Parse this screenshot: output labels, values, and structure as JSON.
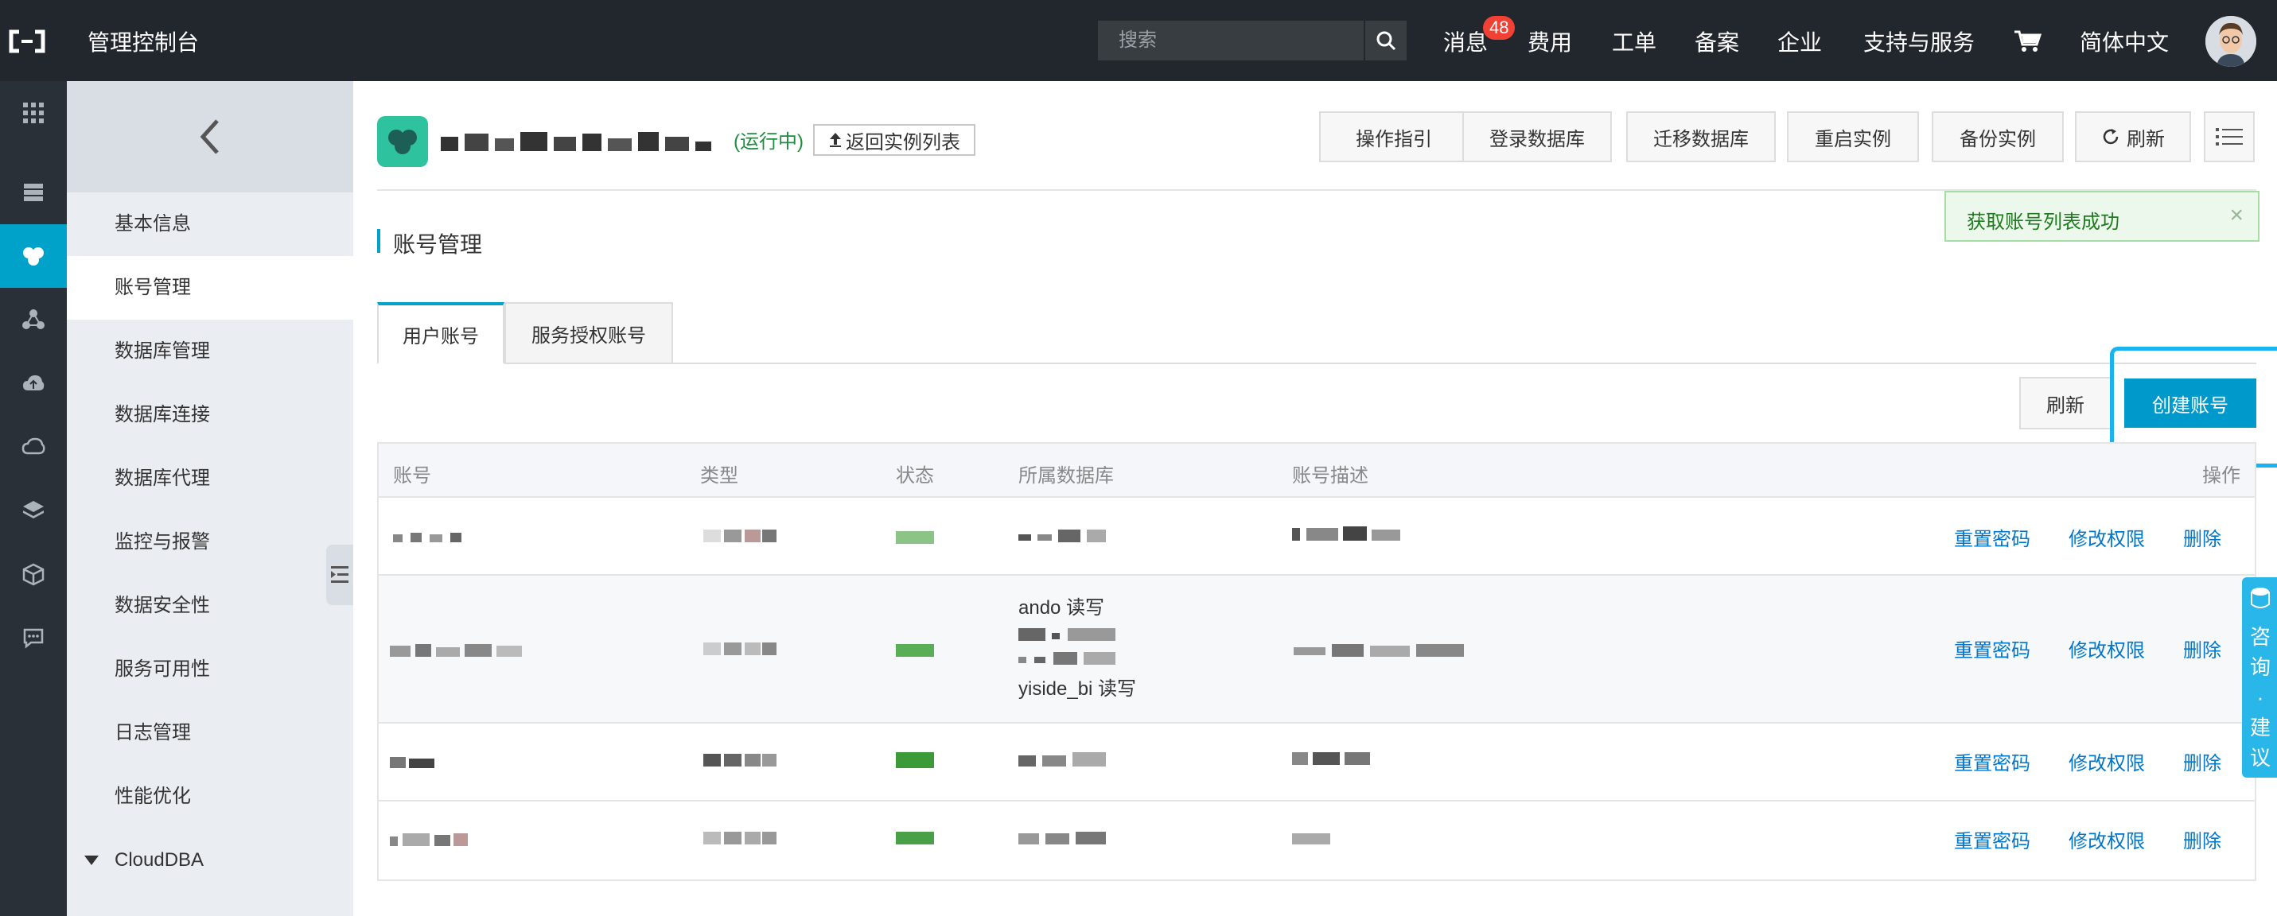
{
  "topbar": {
    "console_title": "管理控制台",
    "search_placeholder": "搜索",
    "messages_label": "消息",
    "messages_badge": "48",
    "nav": [
      "费用",
      "工单",
      "备案",
      "企业",
      "支持与服务"
    ],
    "language": "简体中文"
  },
  "sidebar": {
    "items": [
      {
        "label": "基本信息"
      },
      {
        "label": "账号管理"
      },
      {
        "label": "数据库管理"
      },
      {
        "label": "数据库连接"
      },
      {
        "label": "数据库代理"
      },
      {
        "label": "监控与报警"
      },
      {
        "label": "数据安全性"
      },
      {
        "label": "服务可用性"
      },
      {
        "label": "日志管理"
      },
      {
        "label": "性能优化"
      },
      {
        "label": "CloudDBA"
      }
    ],
    "active_index": 1
  },
  "instance": {
    "status": "(运行中)",
    "back_label": "返回实例列表"
  },
  "toolbar": {
    "guide": "操作指引",
    "login_db": "登录数据库",
    "migrate_db": "迁移数据库",
    "restart": "重启实例",
    "backup": "备份实例",
    "refresh": "刷新"
  },
  "toast": {
    "message": "获取账号列表成功",
    "close": "×"
  },
  "section": {
    "title": "账号管理"
  },
  "tabs": [
    {
      "label": "用户账号",
      "active": true
    },
    {
      "label": "服务授权账号",
      "active": false
    }
  ],
  "actions": {
    "refresh": "刷新",
    "create_account": "创建账号"
  },
  "table": {
    "headers": {
      "account": "账号",
      "type": "类型",
      "status": "状态",
      "database": "所属数据库",
      "description": "账号描述",
      "operation": "操作"
    },
    "row_ops": {
      "reset_password": "重置密码",
      "modify_permission": "修改权限",
      "delete": "删除"
    },
    "row2_db_lines": [
      "ando 读写",
      "yiside_bi 读写"
    ]
  },
  "consult": {
    "label": "咨询·建议"
  },
  "colors": {
    "topbar": "#22272e",
    "accent": "#00a2ca",
    "primary_button": "#0099cc",
    "link": "#0077cc",
    "success_text": "#1e8e3e"
  }
}
